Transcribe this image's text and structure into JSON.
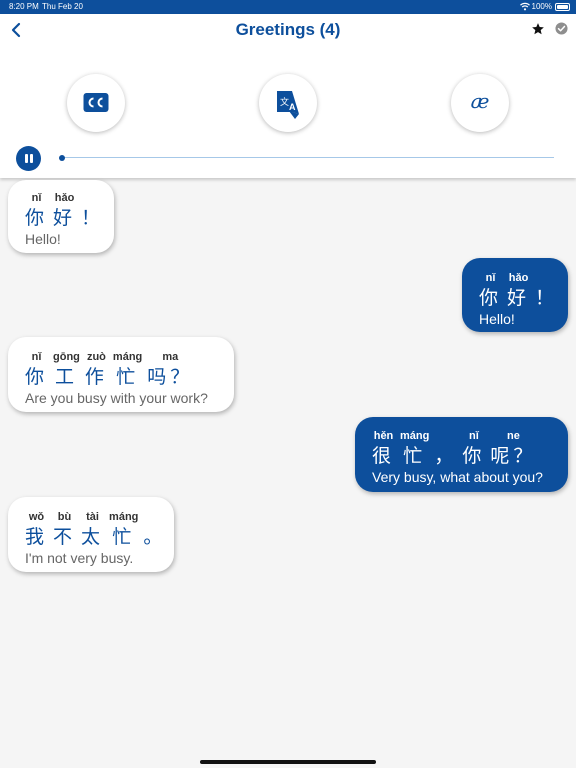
{
  "status_bar": {
    "time": "8:20 PM",
    "date": "Thu Feb 20",
    "battery": "100%"
  },
  "header": {
    "title": "Greetings (4)"
  },
  "colors": {
    "brand": "#0d4f9c",
    "bubble_left": "#ffffff",
    "background": "#f5f5f5",
    "track": "#a6c8e8"
  },
  "icons": {
    "back": "chevron-left-icon",
    "favorite": "star-icon",
    "done": "check-circle-icon",
    "captions": "closed-captions-icon",
    "translate": "translate-icon",
    "phonetic": "ae-ligature-icon"
  },
  "controls": {
    "phonetic_glyph": "æ",
    "playback_progress": 0.0
  },
  "messages": [
    {
      "side": "left",
      "segments": [
        {
          "pinyin": "nǐ",
          "hanzi": "你"
        },
        {
          "pinyin": "hǎo",
          "hanzi": "好"
        },
        {
          "pinyin": "",
          "hanzi": "！"
        }
      ],
      "english": "Hello!"
    },
    {
      "side": "right",
      "segments": [
        {
          "pinyin": "nǐ",
          "hanzi": "你"
        },
        {
          "pinyin": "hǎo",
          "hanzi": "好"
        },
        {
          "pinyin": "",
          "hanzi": "！"
        }
      ],
      "english": "Hello!"
    },
    {
      "side": "left",
      "segments": [
        {
          "pinyin": "nǐ",
          "hanzi": "你"
        },
        {
          "pinyin": "gōng",
          "hanzi": "工"
        },
        {
          "pinyin": "zuò",
          "hanzi": "作"
        },
        {
          "pinyin": "máng",
          "hanzi": "忙"
        },
        {
          "pinyin": "ma",
          "hanzi": "吗？"
        }
      ],
      "english": "Are you busy with your work?"
    },
    {
      "side": "right",
      "segments": [
        {
          "pinyin": "hěn",
          "hanzi": "很"
        },
        {
          "pinyin": "máng",
          "hanzi": "忙"
        },
        {
          "pinyin": "",
          "hanzi": "，"
        },
        {
          "pinyin": "nǐ",
          "hanzi": "你"
        },
        {
          "pinyin": "ne",
          "hanzi": "呢？"
        }
      ],
      "english": "Very busy, what about you?"
    },
    {
      "side": "left",
      "segments": [
        {
          "pinyin": "wǒ",
          "hanzi": "我"
        },
        {
          "pinyin": "bù",
          "hanzi": "不"
        },
        {
          "pinyin": "tài",
          "hanzi": "太"
        },
        {
          "pinyin": "máng",
          "hanzi": "忙"
        },
        {
          "pinyin": "",
          "hanzi": "。"
        }
      ],
      "english": "I'm not very busy."
    }
  ]
}
